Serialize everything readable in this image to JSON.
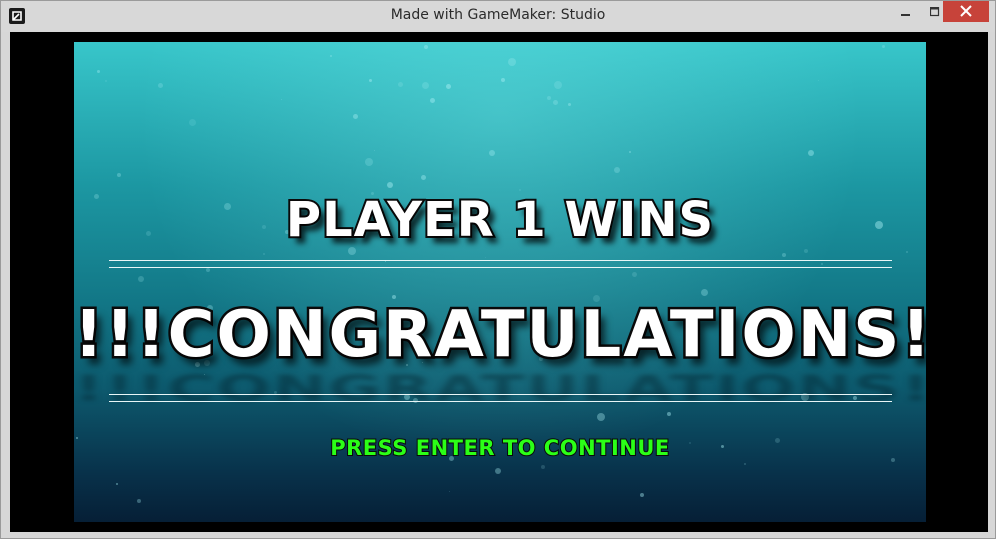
{
  "window": {
    "title": "Made with GameMaker: Studio",
    "icon": "gamemaker-icon",
    "controls": [
      "minimize-icon",
      "maximize-icon",
      "close-icon"
    ],
    "close_color": "#c7433a"
  },
  "game": {
    "winner_text": "PLAYER 1 WINS",
    "congrats_text": "!!!CONGRATULATIONS!!!",
    "prompt_text": "PRESS ENTER TO CONTINUE",
    "colors": {
      "text": "#ffffff",
      "outline": "#0a0a0a",
      "prompt": "#2bff17",
      "background_top": "#38c6ca",
      "background_bottom": "#061f36"
    }
  }
}
